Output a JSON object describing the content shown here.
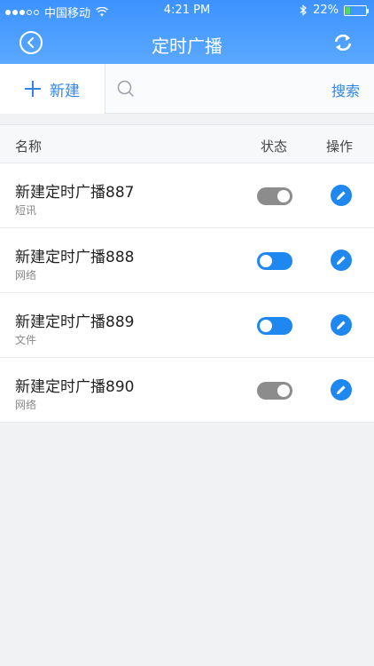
{
  "status_bar": {
    "carrier": "中国移动",
    "time": "4:21 PM",
    "battery_text": "22%",
    "battery_level": 0.22,
    "signal_bars": 3,
    "signal_total": 5
  },
  "nav": {
    "title": "定时广播",
    "back_icon": "chevron-left-icon",
    "refresh_icon": "refresh-icon"
  },
  "toolbar": {
    "new_label": "新建",
    "search_placeholder": "",
    "search_label": "搜索"
  },
  "table": {
    "columns": [
      "名称",
      "状态",
      "操作"
    ],
    "rows": [
      {
        "title": "新建定时广播887",
        "type": "短讯",
        "enabled": false
      },
      {
        "title": "新建定时广播888",
        "type": "网络",
        "enabled": true
      },
      {
        "title": "新建定时广播889",
        "type": "文件",
        "enabled": true
      },
      {
        "title": "新建定时广播890",
        "type": "网络",
        "enabled": false
      }
    ]
  },
  "colors": {
    "header": "#4a9dff",
    "accent": "#1e88f0",
    "toggle_off": "#8c8c8c",
    "background": "#f1f2f4"
  }
}
